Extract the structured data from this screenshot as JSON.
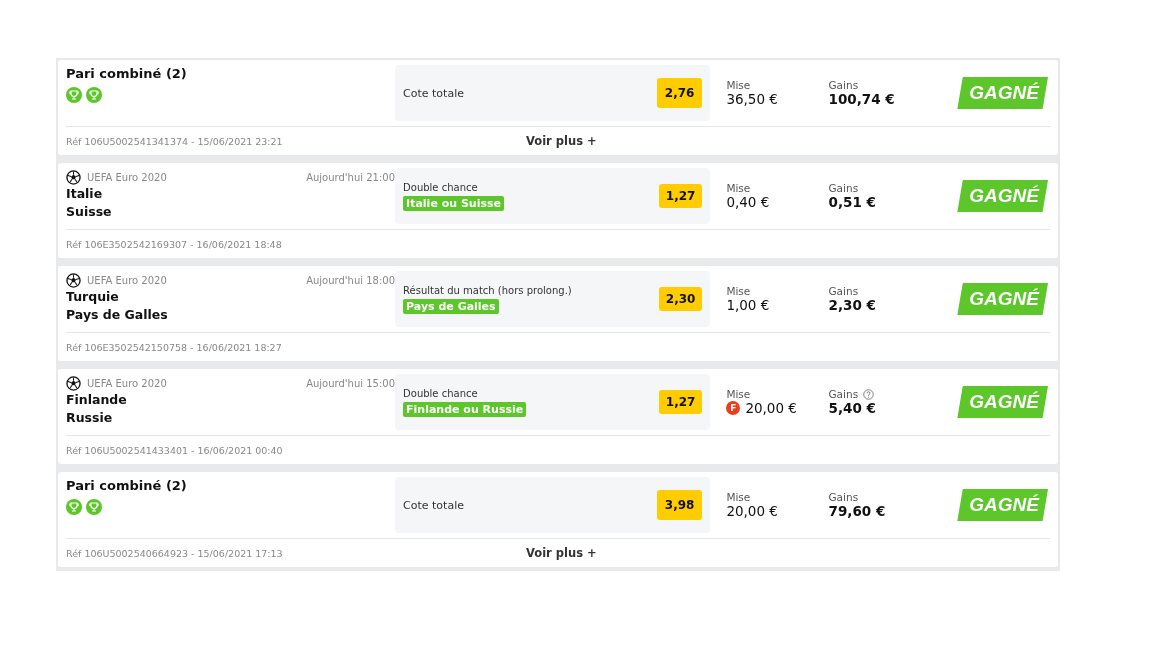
{
  "bets": [
    {
      "kind": "combo",
      "title": "Pari combiné (2)",
      "legs": [
        {
          "won": true
        },
        {
          "won": true
        }
      ],
      "market": "Cote totale",
      "odds": "2,76",
      "stake_label": "Mise",
      "stake": "36,50 €",
      "freebet": false,
      "gains_label": "Gains",
      "gains": "100,74 €",
      "gains_info": false,
      "status": "GAGNÉ",
      "ref": "Réf 106U5002541341374 - 15/06/2021 23:21",
      "more": "Voir plus +"
    },
    {
      "kind": "single",
      "competition": "UEFA Euro 2020",
      "time": "Aujourd'hui 21:00",
      "home": "Italie",
      "away": "Suisse",
      "market": "Double chance",
      "selection": "Italie ou Suisse",
      "odds": "1,27",
      "stake_label": "Mise",
      "stake": "0,40 €",
      "freebet": false,
      "gains_label": "Gains",
      "gains": "0,51 €",
      "gains_info": false,
      "status": "GAGNÉ",
      "ref": "Réf 106E3502542169307 - 16/06/2021 18:48"
    },
    {
      "kind": "single",
      "competition": "UEFA Euro 2020",
      "time": "Aujourd'hui 18:00",
      "home": "Turquie",
      "away": "Pays de Galles",
      "market": "Résultat du match (hors prolong.)",
      "selection": "Pays de Galles",
      "odds": "2,30",
      "stake_label": "Mise",
      "stake": "1,00 €",
      "freebet": false,
      "gains_label": "Gains",
      "gains": "2,30 €",
      "gains_info": false,
      "status": "GAGNÉ",
      "ref": "Réf 106E3502542150758 - 16/06/2021 18:27"
    },
    {
      "kind": "single",
      "competition": "UEFA Euro 2020",
      "time": "Aujourd'hui 15:00",
      "home": "Finlande",
      "away": "Russie",
      "market": "Double chance",
      "selection": "Finlande ou Russie",
      "odds": "1,27",
      "stake_label": "Mise",
      "stake": "20,00 €",
      "freebet": true,
      "freebet_mark": "F",
      "gains_label": "Gains",
      "gains": "5,40 €",
      "gains_info": true,
      "status": "GAGNÉ",
      "ref": "Réf 106U5002541433401 - 16/06/2021 00:40"
    },
    {
      "kind": "combo",
      "title": "Pari combiné (2)",
      "legs": [
        {
          "won": true
        },
        {
          "won": true
        }
      ],
      "market": "Cote totale",
      "odds": "3,98",
      "stake_label": "Mise",
      "stake": "20,00 €",
      "freebet": false,
      "gains_label": "Gains",
      "gains": "79,60 €",
      "gains_info": false,
      "status": "GAGNÉ",
      "ref": "Réf 106U5002540664923 - 15/06/2021 17:13",
      "more": "Voir plus +"
    }
  ]
}
